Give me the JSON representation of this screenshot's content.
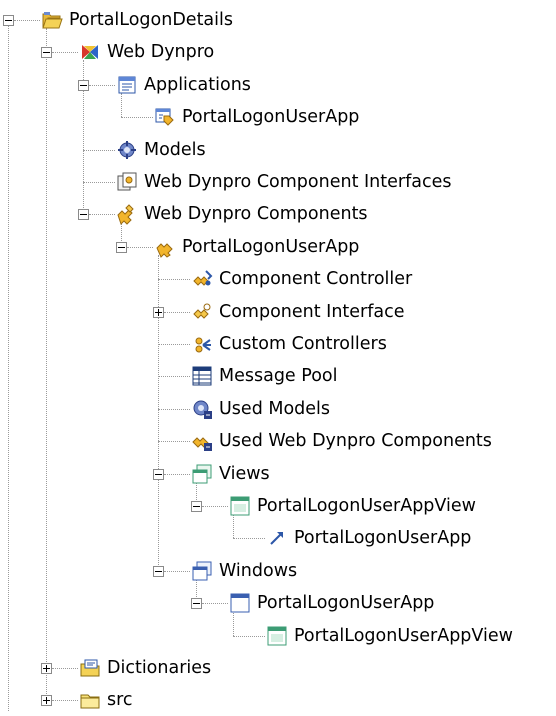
{
  "tree": {
    "items": [
      {
        "label": "PortalLogonDetails",
        "icon": "open-folder-icon",
        "expander": "minus"
      },
      {
        "label": "Web Dynpro",
        "icon": "web-dynpro-icon",
        "expander": "minus"
      },
      {
        "label": "Applications",
        "icon": "applications-icon",
        "expander": "minus"
      },
      {
        "label": "PortalLogonUserApp",
        "icon": "application-icon",
        "expander": ""
      },
      {
        "label": "Models",
        "icon": "models-icon",
        "expander": ""
      },
      {
        "label": "Web Dynpro Component Interfaces",
        "icon": "component-interfaces-icon",
        "expander": ""
      },
      {
        "label": "Web Dynpro Components",
        "icon": "components-icon",
        "expander": "minus"
      },
      {
        "label": "PortalLogonUserApp",
        "icon": "component-icon",
        "expander": "minus"
      },
      {
        "label": "Component Controller",
        "icon": "component-controller-icon",
        "expander": ""
      },
      {
        "label": "Component Interface",
        "icon": "component-interface-icon",
        "expander": "plus"
      },
      {
        "label": "Custom Controllers",
        "icon": "custom-controllers-icon",
        "expander": ""
      },
      {
        "label": "Message Pool",
        "icon": "message-pool-icon",
        "expander": ""
      },
      {
        "label": "Used Models",
        "icon": "used-models-icon",
        "expander": ""
      },
      {
        "label": "Used Web Dynpro Components",
        "icon": "used-components-icon",
        "expander": ""
      },
      {
        "label": "Views",
        "icon": "views-icon",
        "expander": "minus"
      },
      {
        "label": "PortalLogonUserAppView",
        "icon": "view-icon",
        "expander": "minus"
      },
      {
        "label": "PortalLogonUserApp",
        "icon": "navigation-link-icon",
        "expander": ""
      },
      {
        "label": "Windows",
        "icon": "windows-icon",
        "expander": "minus"
      },
      {
        "label": "PortalLogonUserApp",
        "icon": "window-icon",
        "expander": "minus"
      },
      {
        "label": "PortalLogonUserAppView",
        "icon": "view-icon",
        "expander": ""
      },
      {
        "label": "Dictionaries",
        "icon": "dictionaries-icon",
        "expander": "plus"
      },
      {
        "label": "src",
        "icon": "folder-icon",
        "expander": "plus"
      }
    ]
  },
  "colors": {
    "connector_lines": "#9a9a9a",
    "folder_yellow": "#f4d256",
    "view_green": "#3c9c74",
    "window_blue": "#3a5fb0",
    "web_dynpro_red": "#d8372a"
  }
}
